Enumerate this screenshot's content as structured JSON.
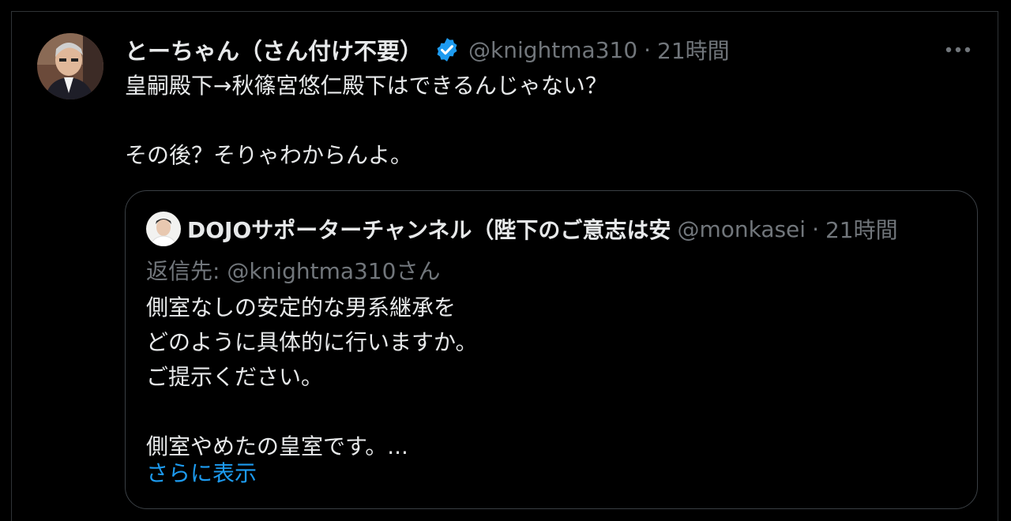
{
  "tweet": {
    "author": {
      "display_name": "とーちゃん（さん付け不要）",
      "handle": "@knightma310",
      "verified": true
    },
    "time": "21時間",
    "separator": "·",
    "text": "皇嗣殿下→秋篠宮悠仁殿下はできるんじゃない？\n\nその後？そりゃわからんよ。",
    "more_icon": "more-dots-icon"
  },
  "quote": {
    "author": {
      "display_name": "DOJOサポーターチャンネル（陛下のご意志は安",
      "handle": "@monkasei"
    },
    "separator": "·",
    "time": "21時間",
    "reply_label": "返信先: ",
    "reply_mention": "@knightma310さん",
    "text": "側室なしの安定的な男系継承を\nどのように具体的に行いますか。\nご提示ください。\n\n側室やめたの皇室です。...",
    "show_more": "さらに表示"
  },
  "colors": {
    "background": "#000000",
    "text_primary": "#e7e9ea",
    "text_secondary": "#71767b",
    "accent": "#1d9bf0",
    "border": "#2f3336"
  }
}
